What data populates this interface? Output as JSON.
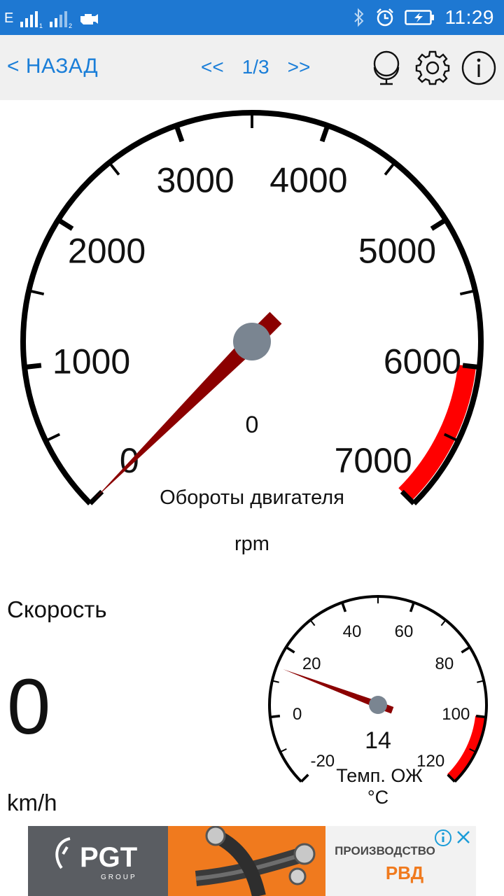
{
  "status_bar": {
    "network": "E",
    "sim1_label": "1",
    "sim2_label": "2",
    "time": "11:29",
    "icons": [
      "signal-icon",
      "signal-icon",
      "engine-icon",
      "bluetooth-icon",
      "alarm-icon",
      "battery-charging-icon"
    ]
  },
  "toolbar": {
    "back_label": "< НАЗАД",
    "prev_label": "<<",
    "page_label": "1/3",
    "next_label": ">>",
    "icons": [
      "globe-icon",
      "gear-icon",
      "info-icon"
    ]
  },
  "rpm_gauge": {
    "title": "Обороты двигателя",
    "unit": "rpm",
    "value": 0,
    "value_label": "0",
    "min": 0,
    "max": 7000,
    "tick_labels": [
      "0",
      "1000",
      "2000",
      "3000",
      "4000",
      "5000",
      "6000",
      "7000"
    ],
    "redline_from": 6000,
    "needle_color": "#8b0000",
    "redline_color": "#ff0000"
  },
  "speed_panel": {
    "title": "Скорость",
    "value": "0",
    "unit": "km/h"
  },
  "coolant_gauge": {
    "title": "Темп. ОЖ",
    "unit": "°C",
    "value": 14,
    "value_label": "14",
    "min": -20,
    "max": 120,
    "tick_labels": [
      "-20",
      "0",
      "20",
      "40",
      "60",
      "80",
      "100",
      "120"
    ],
    "redline_from": 100
  },
  "ad_banner": {
    "brand": "PGT",
    "brand_sub": "GROUP",
    "line1": "ПРОИЗВОДСТВО",
    "line2": "РВД",
    "info_icon": "adchoices-icon",
    "close_icon": "close-icon"
  },
  "colors": {
    "status_bar": "#1e78d2",
    "accent": "#1a7ed8",
    "redline": "#ff0000",
    "needle": "#8b0000",
    "hub": "#7a8591",
    "ad_orange": "#f07a1e"
  }
}
